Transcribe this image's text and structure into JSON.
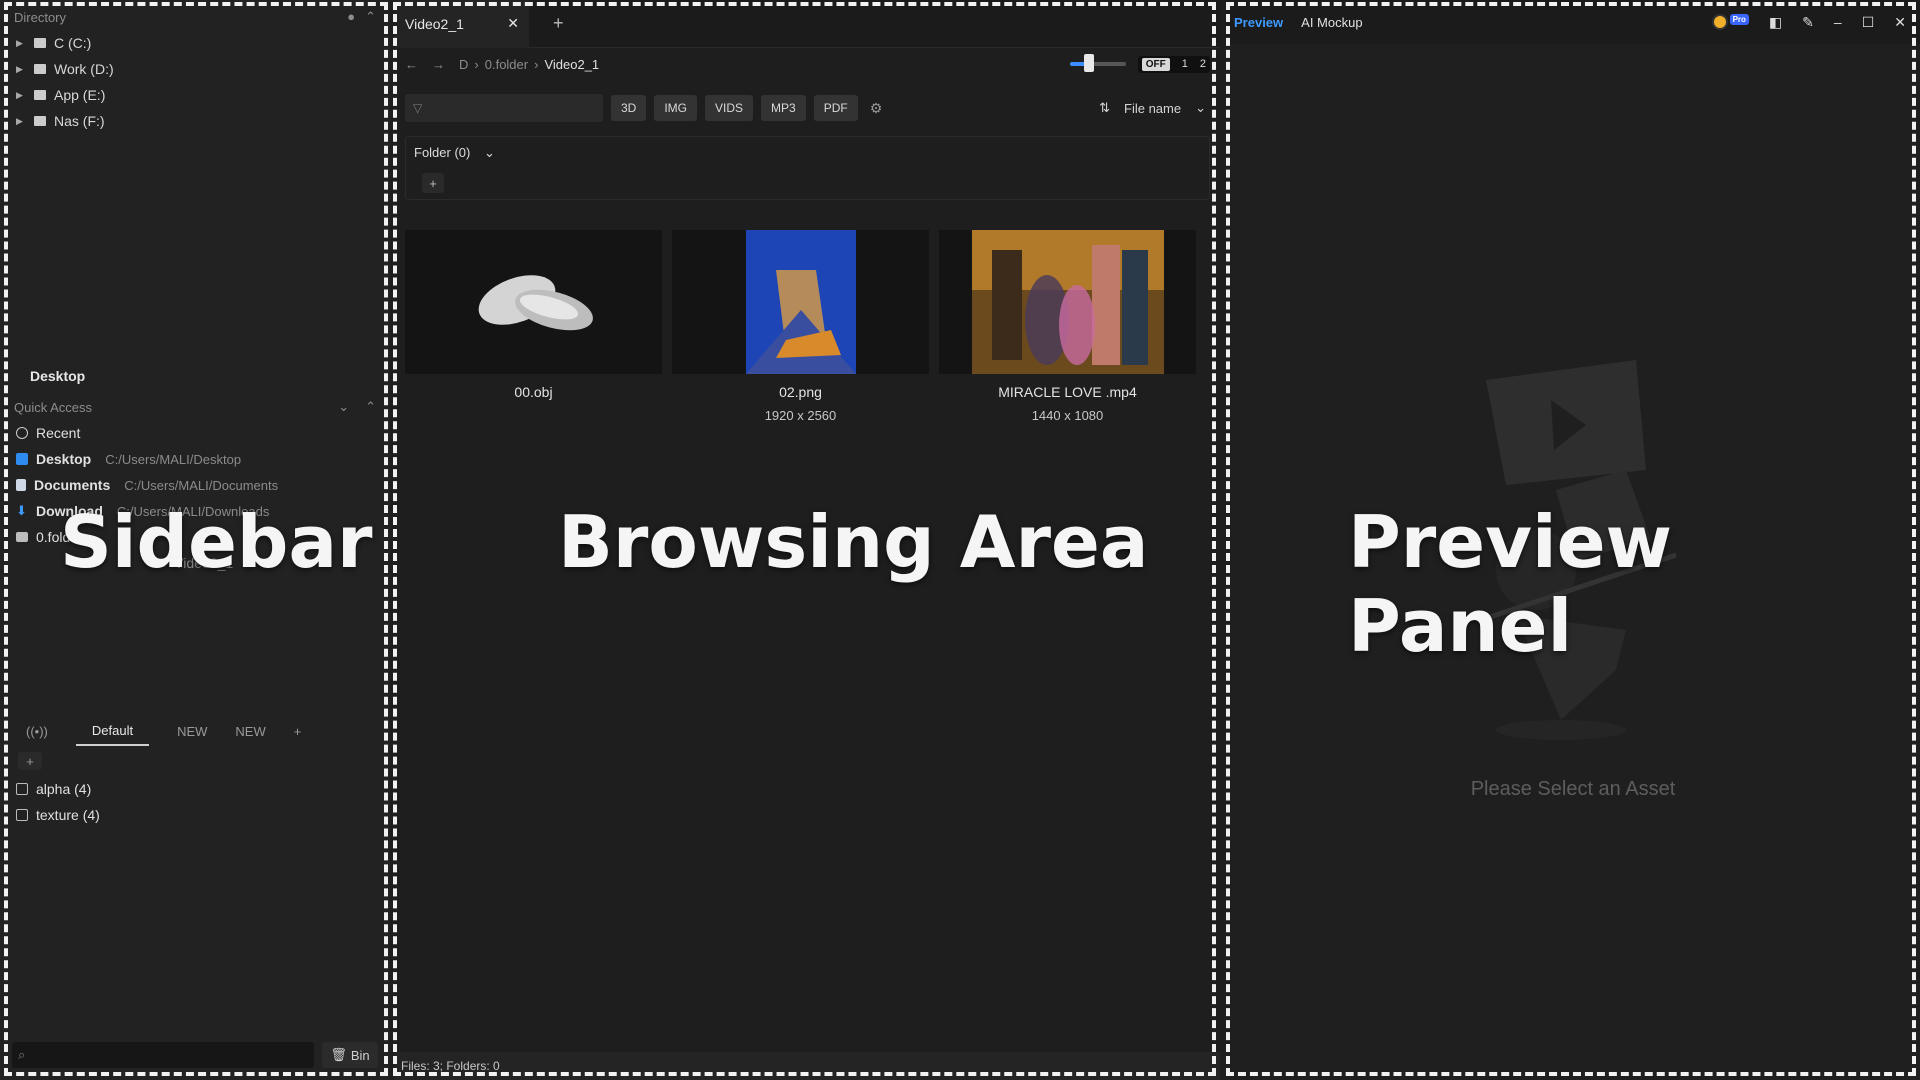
{
  "sidebar": {
    "directory_label": "Directory",
    "drives": [
      {
        "label": "C (C:)"
      },
      {
        "label": "Work (D:)"
      },
      {
        "label": "App (E:)"
      },
      {
        "label": "Nas (F:)"
      }
    ],
    "desktop_label": "Desktop",
    "quick_access_label": "Quick Access",
    "quick_access": [
      {
        "label": "Recent",
        "path": ""
      },
      {
        "label": "Desktop",
        "path": "C:/Users/MALI/Desktop"
      },
      {
        "label": "Documents",
        "path": "C:/Users/MALI/Documents"
      },
      {
        "label": "Download",
        "path": "C:/Users/MALI/Downloads"
      },
      {
        "label": "0.folder",
        "path": ""
      },
      {
        "label": "Video2_1",
        "path": ""
      }
    ],
    "tag_tabs": [
      "Default",
      "NEW",
      "NEW"
    ],
    "tags": [
      {
        "label": "alpha (4)"
      },
      {
        "label": "texture (4)"
      }
    ],
    "bin_label": "Bin"
  },
  "browser": {
    "tab_title": "Video2_1",
    "breadcrumb": [
      "D",
      "0.folder",
      "Video2_1"
    ],
    "toggle": {
      "off": "OFF",
      "one": "1",
      "two": "2"
    },
    "filters": [
      "3D",
      "IMG",
      "VIDS",
      "MP3",
      "PDF"
    ],
    "sort_label": "File name",
    "folder_header": "Folder (0)",
    "assets": [
      {
        "name": "00.obj",
        "dims": ""
      },
      {
        "name": "02.png",
        "dims": "1920 x 2560"
      },
      {
        "name": "MIRACLE LOVE .mp4",
        "dims": "1440 x 1080"
      }
    ],
    "status": "Files: 3; Folders: 0"
  },
  "preview": {
    "tab_preview": "Preview",
    "tab_mockup": "AI Mockup",
    "pro_badge": "Pro",
    "empty_text": "Please Select an Asset"
  },
  "overlay_labels": {
    "sidebar": "Sidebar",
    "browser": "Browsing Area",
    "preview": "Preview Panel"
  },
  "colors": {
    "accent": "#3d9bff",
    "background": "#1e1e1e"
  }
}
